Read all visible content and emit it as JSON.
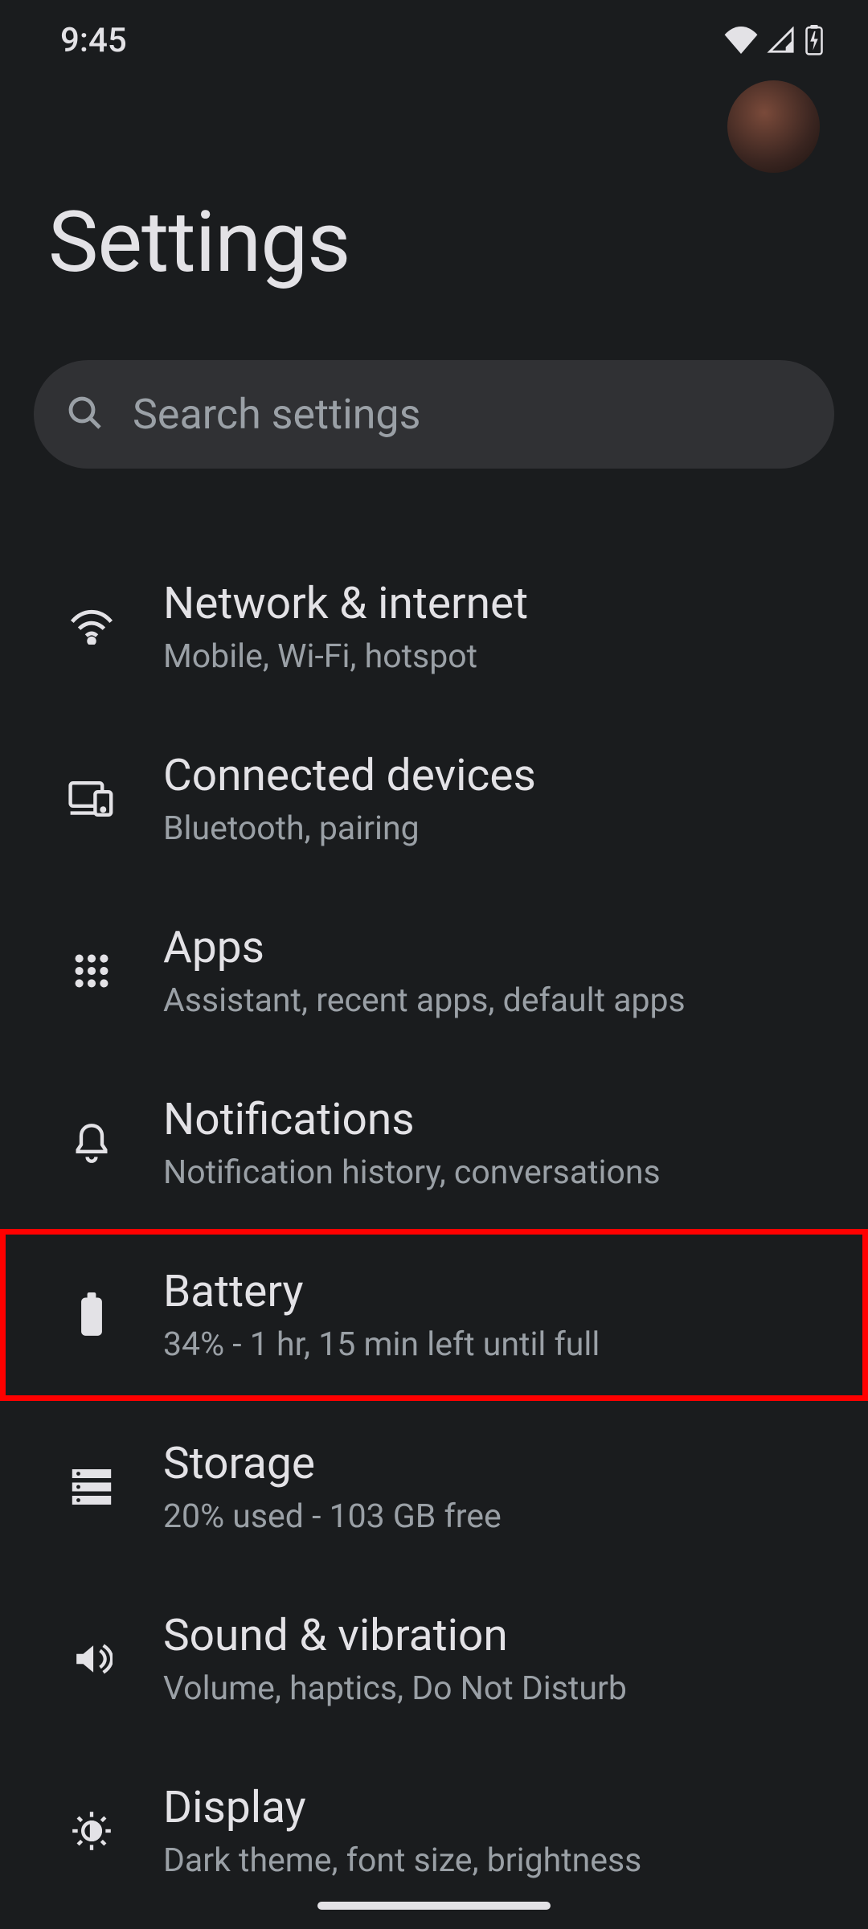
{
  "statusBar": {
    "time": "9:45"
  },
  "header": {
    "title": "Settings"
  },
  "search": {
    "placeholder": "Search settings"
  },
  "items": [
    {
      "title": "Network & internet",
      "subtitle": "Mobile, Wi-Fi, hotspot"
    },
    {
      "title": "Connected devices",
      "subtitle": "Bluetooth, pairing"
    },
    {
      "title": "Apps",
      "subtitle": "Assistant, recent apps, default apps"
    },
    {
      "title": "Notifications",
      "subtitle": "Notification history, conversations"
    },
    {
      "title": "Battery",
      "subtitle": "34% - 1 hr, 15 min left until full"
    },
    {
      "title": "Storage",
      "subtitle": "20% used - 103 GB free"
    },
    {
      "title": "Sound & vibration",
      "subtitle": "Volume, haptics, Do Not Disturb"
    },
    {
      "title": "Display",
      "subtitle": "Dark theme, font size, brightness"
    }
  ]
}
